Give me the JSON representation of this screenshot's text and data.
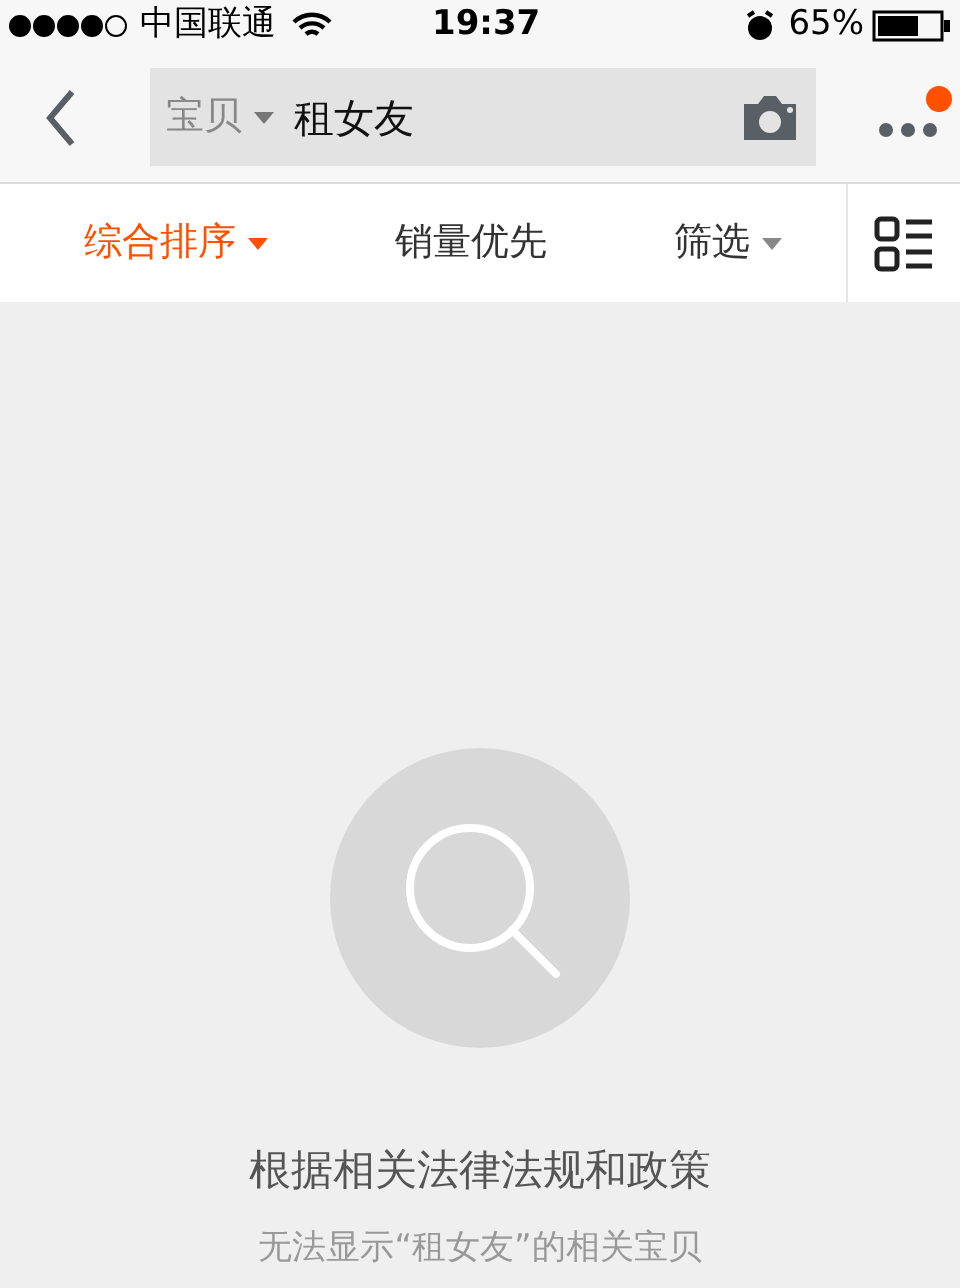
{
  "status_bar": {
    "carrier": "中国联通",
    "time": "19:37",
    "battery": "65%"
  },
  "search": {
    "scope": "宝贝",
    "query": "租女友",
    "has_notification": true
  },
  "sort_tabs": [
    {
      "label": "综合排序",
      "selected": true,
      "dropdown": true
    },
    {
      "label": "销量优先",
      "selected": false,
      "dropdown": false
    },
    {
      "label": "筛选",
      "selected": false,
      "dropdown": true
    }
  ],
  "empty_state": {
    "title": "根据相关法律法规和政策",
    "message": "无法显示“租女友”的相关宝贝"
  }
}
